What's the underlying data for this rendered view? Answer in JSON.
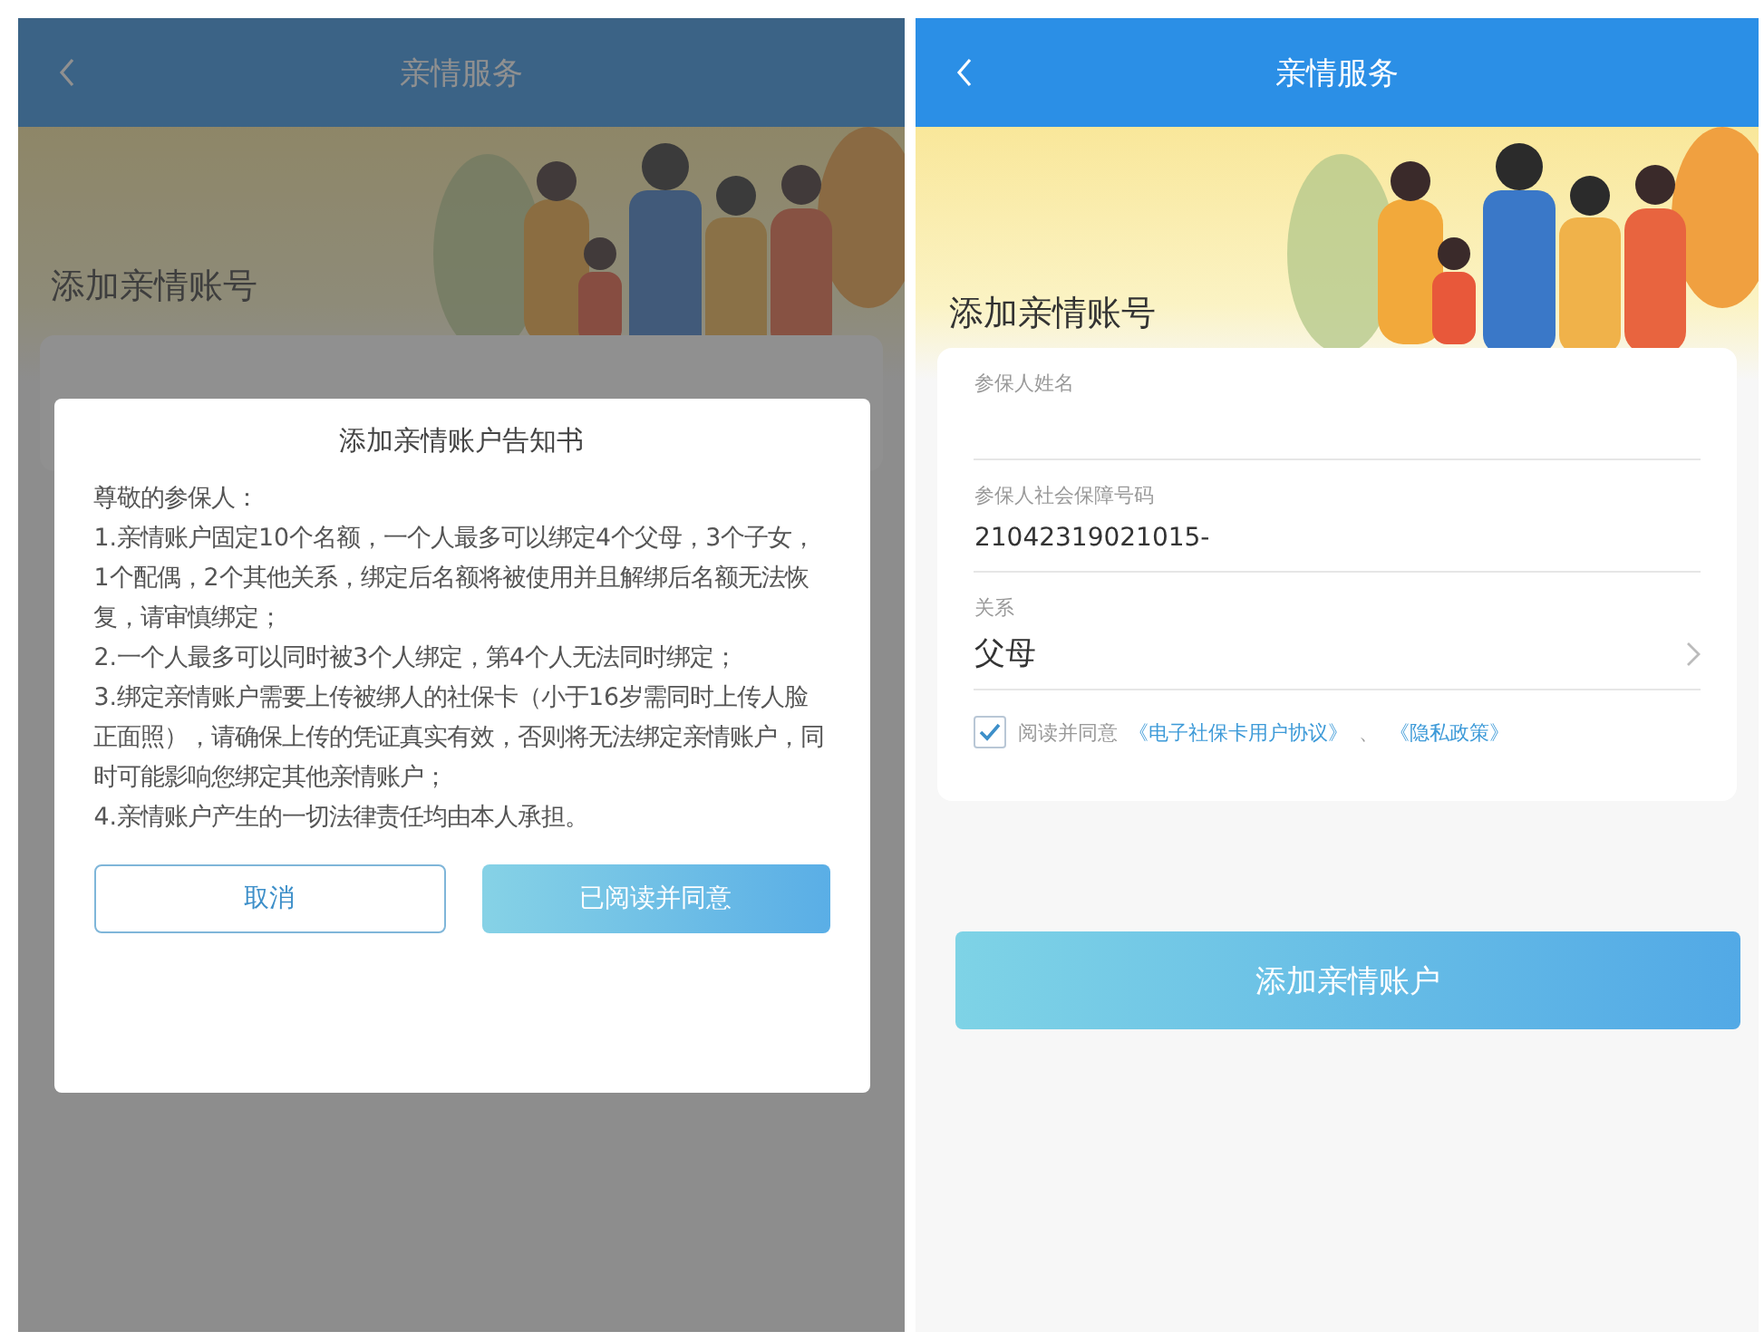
{
  "left_screen": {
    "header": {
      "title": "亲情服务"
    },
    "page_title": "添加亲情账号",
    "dialog": {
      "title": "添加亲情账户告知书",
      "greeting": "尊敬的参保人：",
      "paragraphs": [
        "1.亲情账户固定10个名额，一个人最多可以绑定4个父母，3个子女，1个配偶，2个其他关系，绑定后名额将被使用并且解绑后名额无法恢复，请审慎绑定；",
        "2.一个人最多可以同时被3个人绑定，第4个人无法同时绑定；",
        "3.绑定亲情账户需要上传被绑人的社保卡（小于16岁需同时上传人脸正面照），请确保上传的凭证真实有效，否则将无法绑定亲情账户，同时可能影响您绑定其他亲情账户；",
        "4.亲情账户产生的一切法律责任均由本人承担。"
      ],
      "buttons": [
        {
          "label": "取消",
          "kind": "secondary"
        },
        {
          "label": "已阅读并同意",
          "kind": "primary"
        }
      ]
    }
  },
  "right_screen": {
    "header": {
      "title": "亲情服务"
    },
    "page_title": "添加亲情账号",
    "fields": [
      {
        "label": "参保人姓名",
        "kind": "text"
      },
      {
        "label": "参保人社会保障号码",
        "value": "21042319021015-",
        "kind": "text"
      },
      {
        "label": "关系",
        "value": "父母",
        "kind": "select"
      }
    ],
    "agreement": {
      "checked": true,
      "prefix": "阅读并同意",
      "link_1": "《电子社保卡用户协议》",
      "separator": "、",
      "link_2": "《隐私政策》"
    },
    "submit_button": {
      "label": "添加亲情账户"
    }
  }
}
